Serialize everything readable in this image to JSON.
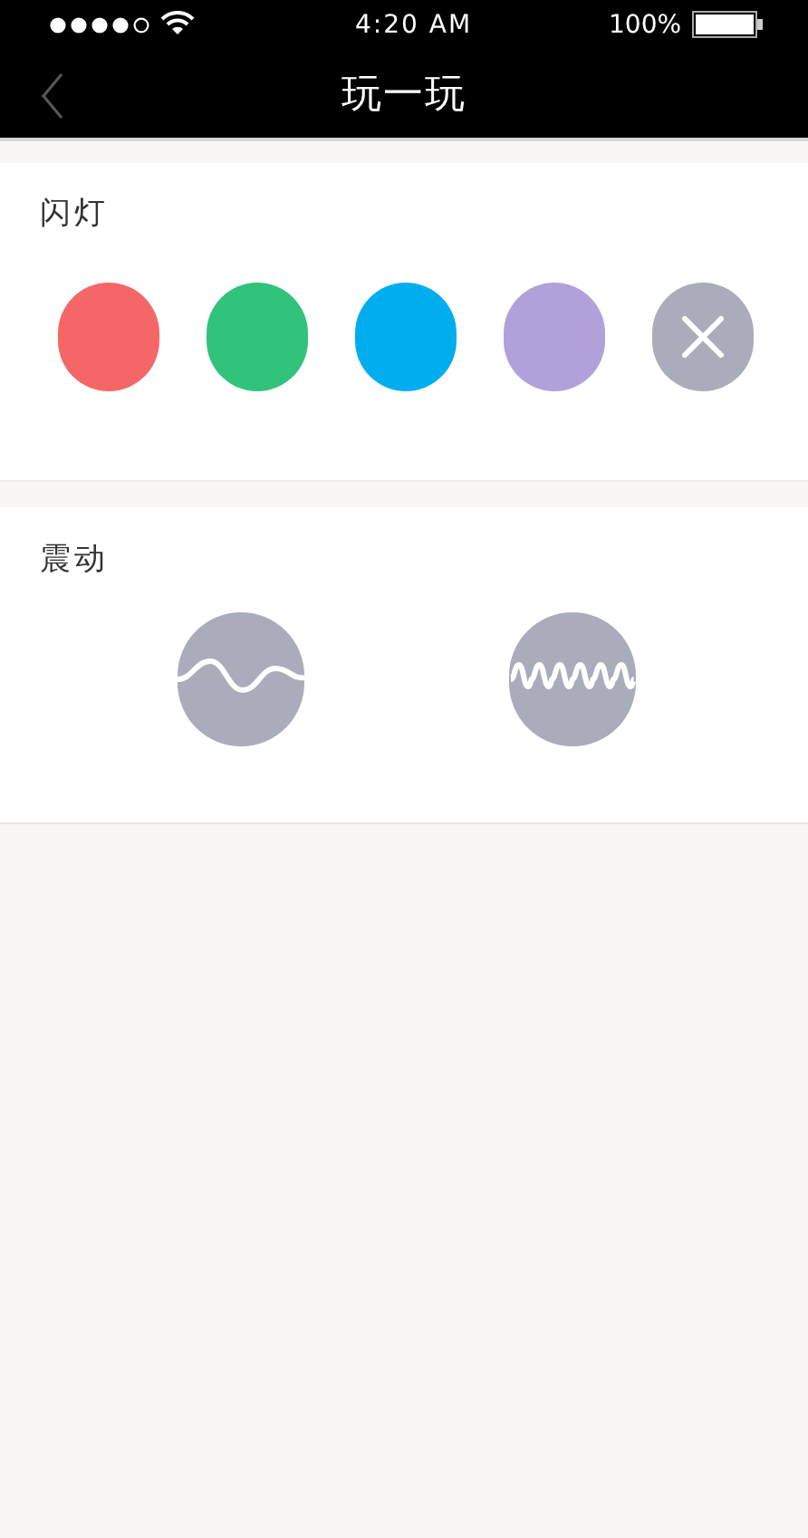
{
  "status_bar": {
    "time": "4:20 AM",
    "battery": "100%"
  },
  "nav": {
    "title": "玩一玩"
  },
  "flash": {
    "title": "闪灯",
    "items": [
      {
        "kind": "color",
        "color": "#f56767"
      },
      {
        "kind": "color",
        "color": "#31c27c"
      },
      {
        "kind": "color",
        "color": "#00aeef"
      },
      {
        "kind": "color",
        "color": "#b0a1da"
      },
      {
        "kind": "off"
      }
    ]
  },
  "vibration": {
    "title": "震动",
    "items": [
      {
        "kind": "slow"
      },
      {
        "kind": "fast"
      }
    ]
  }
}
